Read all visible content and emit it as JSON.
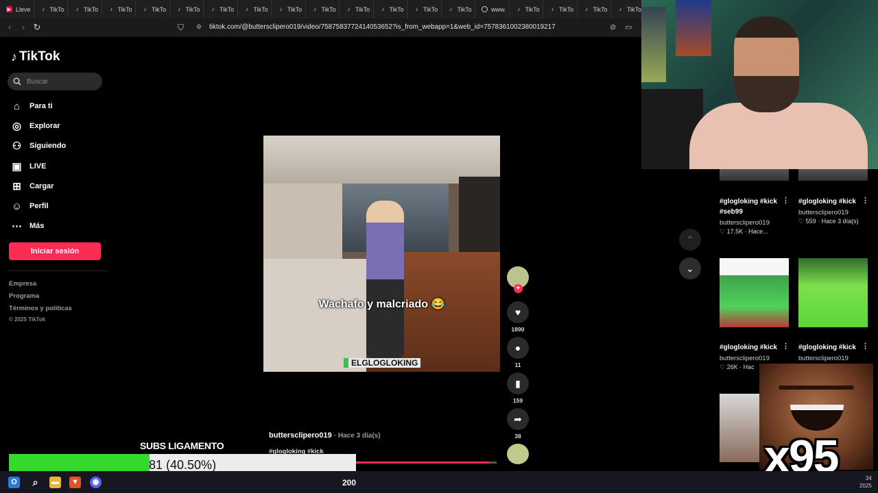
{
  "browser": {
    "tabs": [
      {
        "label": "Lleve",
        "icon": "youtube-icon"
      },
      {
        "label": "TikTo",
        "icon": "tiktok-icon"
      },
      {
        "label": "TikTo",
        "icon": "tiktok-icon"
      },
      {
        "label": "TikTo",
        "icon": "tiktok-icon"
      },
      {
        "label": "TikTo",
        "icon": "tiktok-icon"
      },
      {
        "label": "TikTo",
        "icon": "tiktok-icon"
      },
      {
        "label": "TikTo",
        "icon": "tiktok-icon"
      },
      {
        "label": "TikTo",
        "icon": "tiktok-icon"
      },
      {
        "label": "TikTo",
        "icon": "tiktok-icon"
      },
      {
        "label": "TikTo",
        "icon": "tiktok-icon"
      },
      {
        "label": "TikTo",
        "icon": "tiktok-icon"
      },
      {
        "label": "TikTo",
        "icon": "tiktok-icon"
      },
      {
        "label": "TikTo",
        "icon": "tiktok-icon"
      },
      {
        "label": "TikTo",
        "icon": "tiktok-icon"
      },
      {
        "label": "www.",
        "icon": "globe-icon"
      },
      {
        "label": "TikTo",
        "icon": "tiktok-icon"
      },
      {
        "label": "TikTo",
        "icon": "tiktok-icon"
      },
      {
        "label": "TikTo",
        "icon": "tiktok-icon"
      },
      {
        "label": "TikTo",
        "icon": "tiktok-icon"
      }
    ],
    "url": "tiktok.com/@buttersclipero019/video/7587583772414053652?is_from_webapp=1&web_id=7578361002380019217"
  },
  "sidebar": {
    "brand": "TikTok",
    "search_placeholder": "Buscar",
    "nav": [
      {
        "label": "Para ti",
        "icon": "home-icon"
      },
      {
        "label": "Explorar",
        "icon": "compass-icon"
      },
      {
        "label": "Siguiendo",
        "icon": "following-icon"
      },
      {
        "label": "LIVE",
        "icon": "live-icon"
      },
      {
        "label": "Cargar",
        "icon": "upload-icon"
      },
      {
        "label": "Perfil",
        "icon": "profile-icon"
      },
      {
        "label": "Más",
        "icon": "more-icon"
      }
    ],
    "login_label": "Iniciar sesión",
    "footer": [
      "Empresa",
      "Programa",
      "Términos y políticas"
    ],
    "copyright": "© 2025 TikTok"
  },
  "video": {
    "caption_text": "Wachafo y malcriado 😂",
    "watermark": "ELGLOGLOKING",
    "author": "buttersclipero019",
    "age": "· Hace 3 día(s)",
    "tags": "#glogloking #kick",
    "progress": 0.97,
    "likes": "1890",
    "comments": "11",
    "saves": "159",
    "shares": "38"
  },
  "grid": [
    {
      "title": "#glogloking #kick #seb99",
      "author": "buttersclipero019",
      "meta": "♡ 17.5K · Hace..."
    },
    {
      "title": "#glogloking #kick",
      "author": "buttersclipero019",
      "meta": "♡ 559 · Hace 3 día(s)"
    },
    {
      "title": "#glogloking #kick",
      "author": "buttersclipero019",
      "meta": "♡ 26K · Hac"
    },
    {
      "title": "#glogloking #kick",
      "author": "buttersclipero019",
      "meta": ""
    }
  ],
  "overlay": {
    "combo": "x95",
    "subs_label": "SUBS LIGAMENTO",
    "subs_text": "81 (40.50%)",
    "subs_progress": 0.405,
    "viewer_count": "200",
    "time_line1": "34",
    "time_line2": "2025"
  },
  "colors": {
    "accent": "#fe2c55",
    "goal_fill": "#35d92c"
  }
}
